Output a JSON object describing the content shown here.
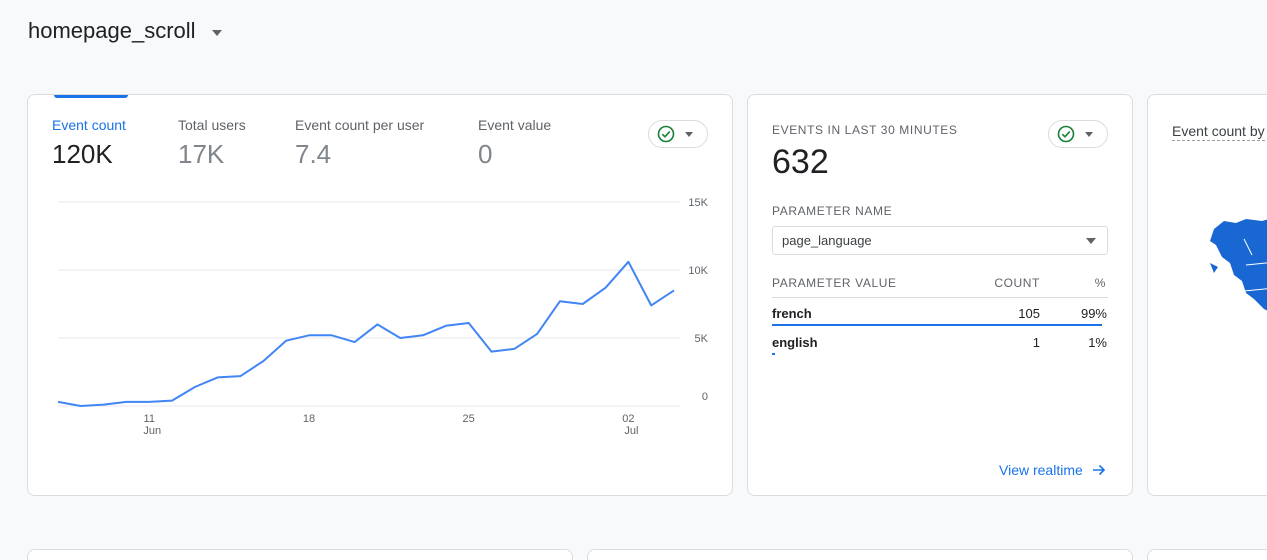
{
  "page": {
    "title": "homepage_scroll"
  },
  "metrics": [
    {
      "label": "Event count",
      "value": "120K"
    },
    {
      "label": "Total users",
      "value": "17K"
    },
    {
      "label": "Event count per user",
      "value": "7.4"
    },
    {
      "label": "Event value",
      "value": "0"
    }
  ],
  "chart_data": {
    "type": "line",
    "y_ticks": [
      "15K",
      "10K",
      "5K",
      "0"
    ],
    "ylim": [
      0,
      15000
    ],
    "x_ticks": [
      {
        "day": 11,
        "label": "11",
        "sublabel": "Jun"
      },
      {
        "day": 18,
        "label": "18",
        "sublabel": ""
      },
      {
        "day": 25,
        "label": "25",
        "sublabel": ""
      },
      {
        "day": 32,
        "label": "02",
        "sublabel": "Jul"
      }
    ],
    "series": [
      {
        "color": "#4285f4",
        "x": [
          "Jun 7",
          "Jun 8",
          "Jun 9",
          "Jun 10",
          "Jun 11",
          "Jun 12",
          "Jun 13",
          "Jun 14",
          "Jun 15",
          "Jun 16",
          "Jun 17",
          "Jun 18",
          "Jun 19",
          "Jun 20",
          "Jun 21",
          "Jun 22",
          "Jun 23",
          "Jun 24",
          "Jun 25",
          "Jun 26",
          "Jun 27",
          "Jun 28",
          "Jun 29",
          "Jun 30",
          "Jul 1",
          "Jul 2",
          "Jul 3",
          "Jul 4"
        ],
        "values": [
          300,
          0,
          100,
          300,
          300,
          400,
          1400,
          2100,
          2200,
          3300,
          4800,
          5200,
          5200,
          4700,
          6000,
          5000,
          5200,
          5900,
          6100,
          4000,
          4200,
          5300,
          7700,
          7500,
          8700,
          10600,
          7400,
          8500
        ]
      }
    ]
  },
  "realtime": {
    "title": "EVENTS IN LAST 30 MINUTES",
    "count": "632",
    "param_label": "PARAMETER NAME",
    "param_value": "page_language",
    "col_value": "PARAMETER VALUE",
    "col_count": "COUNT",
    "col_pct": "%",
    "rows": [
      {
        "name": "french",
        "count": "105",
        "pct": "99%",
        "fraction": 0.99
      },
      {
        "name": "english",
        "count": "1",
        "pct": "1%",
        "fraction": 0.01
      }
    ],
    "link": "View realtime"
  },
  "map": {
    "title": "Event count by"
  },
  "colors": {
    "accent": "#1a73e8",
    "line": "#4285f4",
    "check": "#188038",
    "map": "#1967d2"
  }
}
